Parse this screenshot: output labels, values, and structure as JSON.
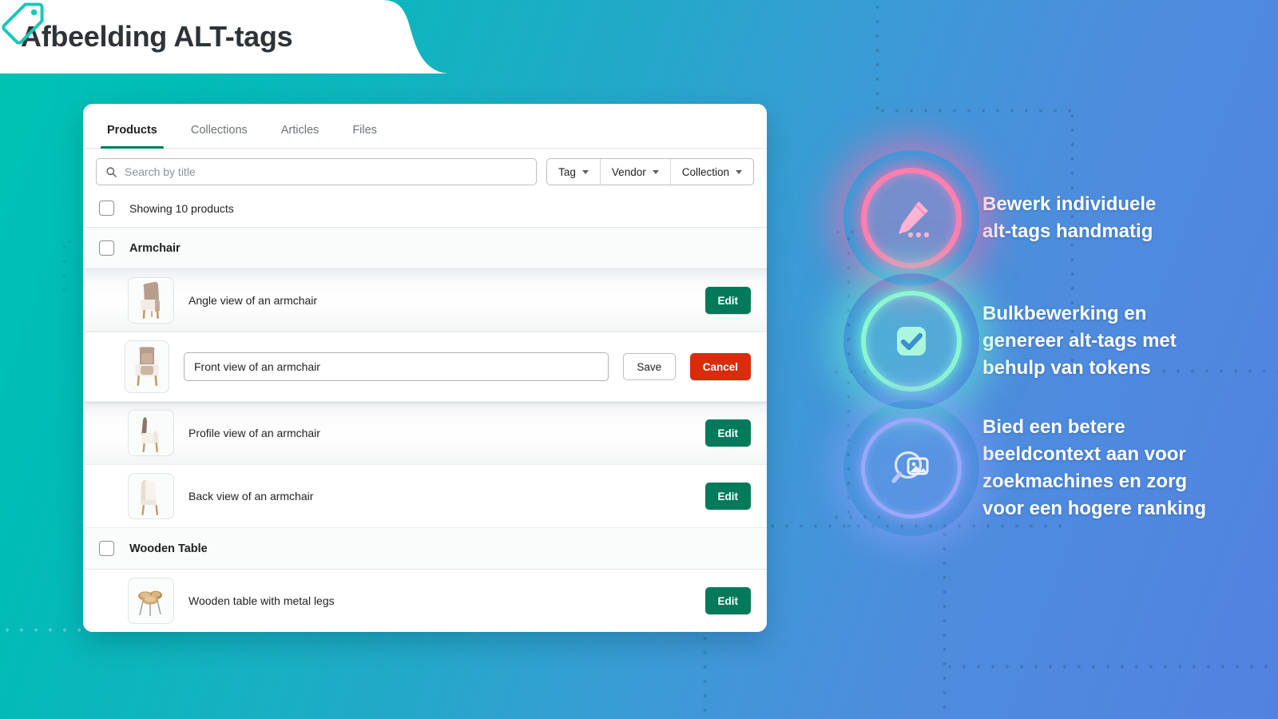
{
  "header": {
    "title": "Afbeelding ALT-tags",
    "icon": "tag-icon"
  },
  "colors": {
    "accent_green": "#007A5A",
    "danger_red": "#D82C0D",
    "brand_teal": "#00C4B4",
    "brand_blue": "#5282E0",
    "neon_pink": "#FF7FB0",
    "neon_mint": "#8CF5D2",
    "neon_periwinkle": "#9AA7FB"
  },
  "app": {
    "tabs": [
      {
        "label": "Products",
        "active": true
      },
      {
        "label": "Collections",
        "active": false
      },
      {
        "label": "Articles",
        "active": false
      },
      {
        "label": "Files",
        "active": false
      }
    ],
    "search": {
      "placeholder": "Search by title",
      "value": "",
      "icon": "search-icon"
    },
    "filters": [
      {
        "label": "Tag"
      },
      {
        "label": "Vendor"
      },
      {
        "label": "Collection"
      }
    ],
    "count_text": "Showing 10 products",
    "groups": [
      {
        "title": "Armchair",
        "rows": [
          {
            "alt": "Angle view of an armchair",
            "mode": "view",
            "button": "Edit",
            "thumb": "armchair-angle"
          },
          {
            "alt": "Front view of an armchair",
            "mode": "edit",
            "save": "Save",
            "cancel": "Cancel",
            "thumb": "armchair-front"
          },
          {
            "alt": "Profile view of an armchair",
            "mode": "view",
            "button": "Edit",
            "thumb": "armchair-profile"
          },
          {
            "alt": "Back view of an armchair",
            "mode": "view",
            "button": "Edit",
            "thumb": "armchair-back"
          }
        ]
      },
      {
        "title": "Wooden Table",
        "rows": [
          {
            "alt": "Wooden table with metal legs",
            "mode": "view",
            "button": "Edit",
            "thumb": "wooden-table"
          }
        ]
      }
    ]
  },
  "features": [
    {
      "icon": "pencil-dots-icon",
      "line1": "Bewerk individuele",
      "line2": "alt-tags handmatig",
      "line3": "",
      "line4": "",
      "color": "#FF7FB0"
    },
    {
      "icon": "checkbox-check-icon",
      "line1": "Bulkbewerking en",
      "line2": "genereer alt-tags met",
      "line3": "behulp van tokens",
      "line4": "",
      "color": "#8CF5D2"
    },
    {
      "icon": "image-search-icon",
      "line1": "Bied een betere",
      "line2": "beeldcontext aan voor",
      "line3": "zoekmachines en zorg",
      "line4": "voor een hogere ranking",
      "color": "#9AA7FB"
    }
  ]
}
